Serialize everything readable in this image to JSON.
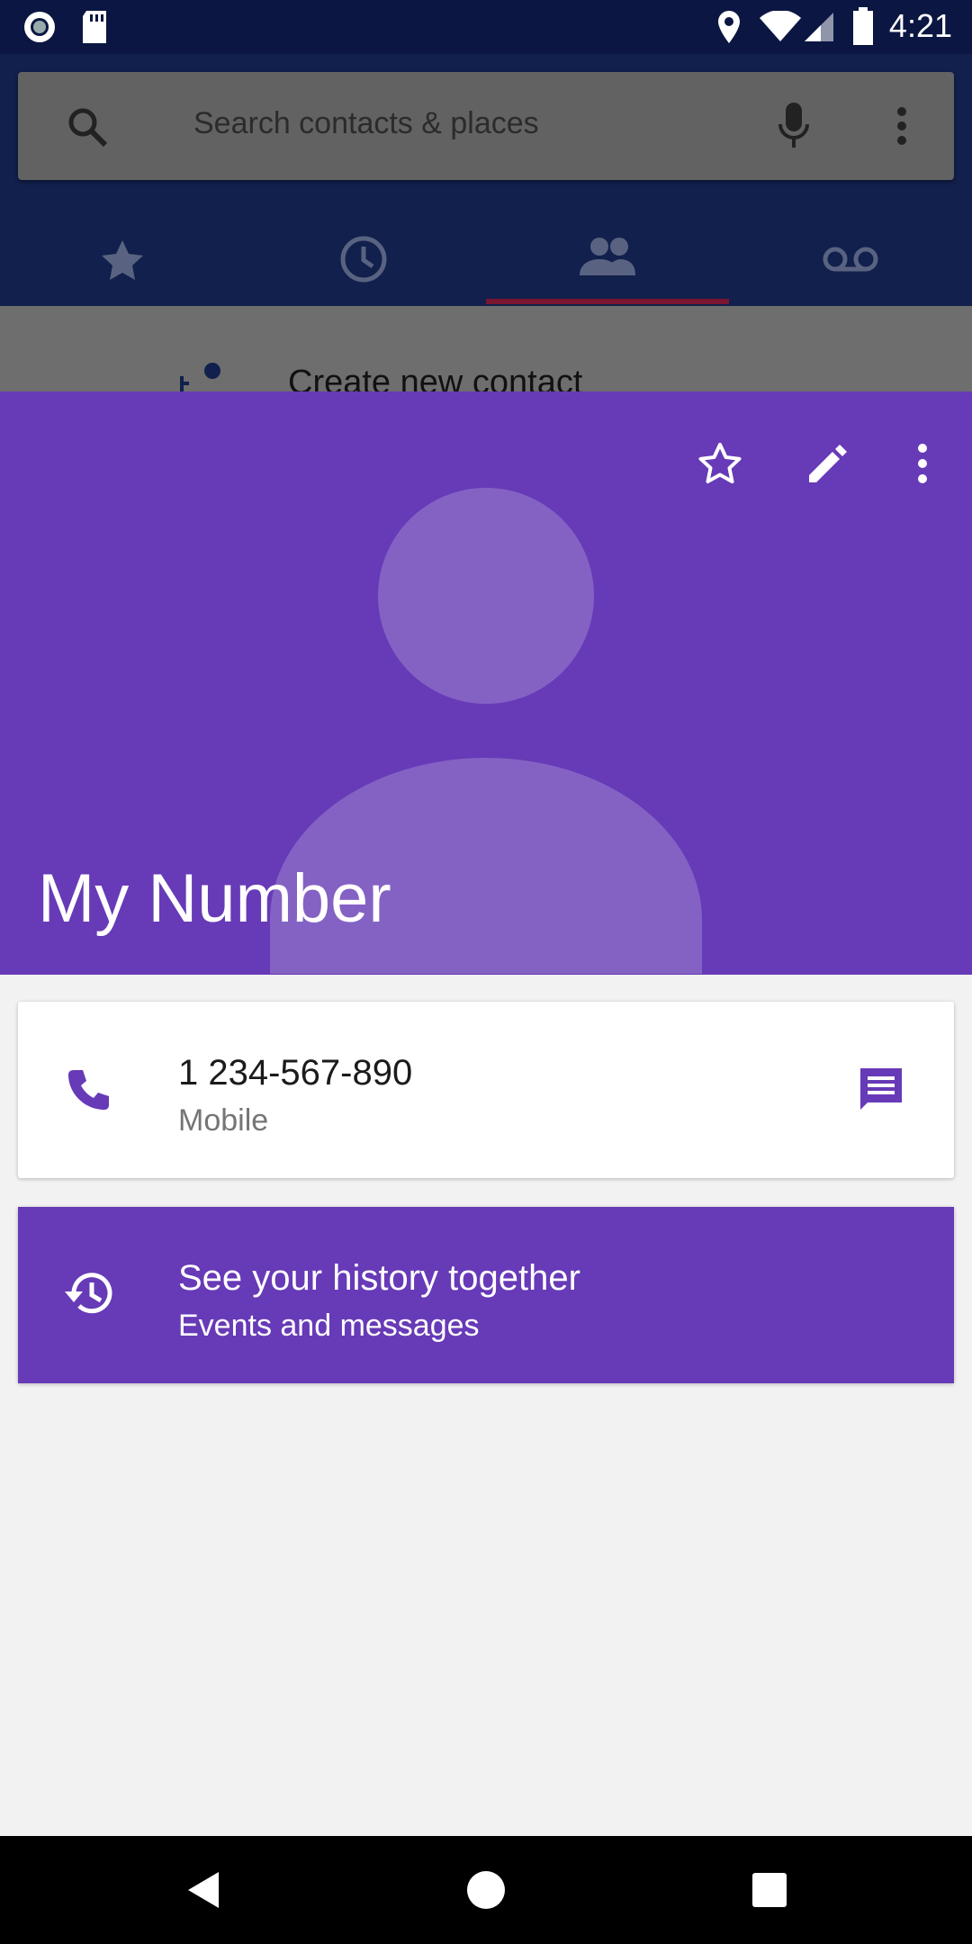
{
  "status_bar": {
    "time": "4:21",
    "left_icons": [
      "record-icon",
      "sd-card-icon"
    ],
    "right_icons": [
      "location-icon",
      "wifi-icon",
      "signal-icon",
      "battery-icon"
    ]
  },
  "search": {
    "placeholder": "Search contacts & places"
  },
  "tabs": [
    {
      "icon": "star-icon",
      "active": false
    },
    {
      "icon": "clock-icon",
      "active": false
    },
    {
      "icon": "people-icon",
      "active": true
    },
    {
      "icon": "voicemail-icon",
      "active": false
    }
  ],
  "background_row": {
    "label": "Create new contact"
  },
  "contact": {
    "name": "My Number",
    "header_color": "#673ab7",
    "actions": [
      "star-outline-icon",
      "edit-icon",
      "more-vert-icon"
    ]
  },
  "phone_entry": {
    "number": "1 234-567-890",
    "type": "Mobile"
  },
  "history_card": {
    "title": "See your history together",
    "subtitle": "Events and messages"
  },
  "colors": {
    "accent": "#673ab7",
    "status_bar": "#0b1642",
    "app_bar": "#11204c"
  }
}
